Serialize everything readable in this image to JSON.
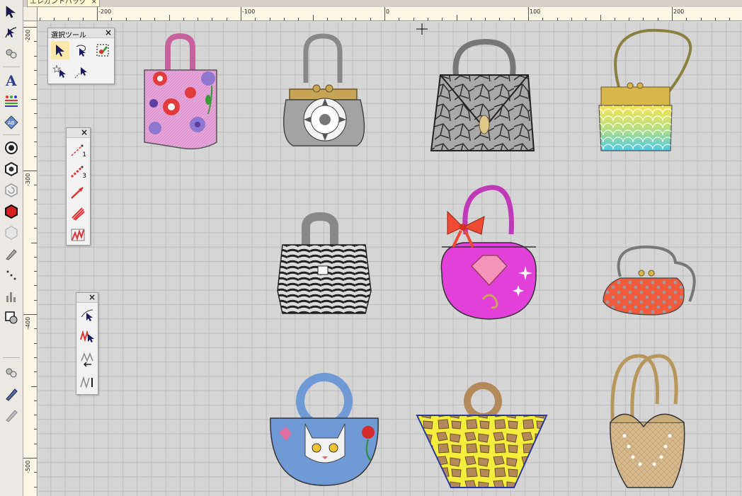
{
  "document": {
    "tab_title": "エレガントバッグ",
    "tab_close": "×"
  },
  "ruler": {
    "top_labels": [
      "-200",
      "-100",
      "0",
      "100",
      "200"
    ],
    "left_labels": [
      "-200",
      "-300",
      "-400",
      "-500"
    ]
  },
  "selection_palette": {
    "title": "選択ツール",
    "close": "×",
    "tools": [
      "select-arrow-icon",
      "lasso-select-icon",
      "color-select-icon",
      "star-select-icon",
      "point-select-icon"
    ]
  },
  "line_palette": {
    "close": "×",
    "tools": [
      "running-stitch-1-icon",
      "running-stitch-3-icon",
      "arrow-line-icon",
      "satin-line-icon",
      "zigzag-line-icon"
    ],
    "labels": [
      "1",
      "3"
    ]
  },
  "edit_palette": {
    "close": "×",
    "tools": [
      "reshape-icon",
      "stitch-edit-icon",
      "insert-stitch-icon",
      "stitch-count-icon"
    ]
  },
  "left_toolbar": {
    "tools": [
      "select-tool-icon",
      "reshape-tool-icon",
      "pan-tool-icon",
      "text-tool-icon",
      "monogram-tool-icon",
      "shape-tool-icon",
      "circle-tool-icon",
      "hexagon-tool-icon",
      "spiral-tool-icon",
      "hexagon-red-tool-icon",
      "hexagon-gray-tool-icon",
      "knife-tool-icon",
      "dot-tool-icon",
      "stitch-density-icon",
      "color-swatch-icon",
      "thread-spool-icon",
      "pen-tool-icon",
      "pencil-tool-icon"
    ]
  },
  "colors": {
    "canvas": "#d5d5d5",
    "grid": "#bdbdbd",
    "ruler": "#fbf7e4"
  }
}
